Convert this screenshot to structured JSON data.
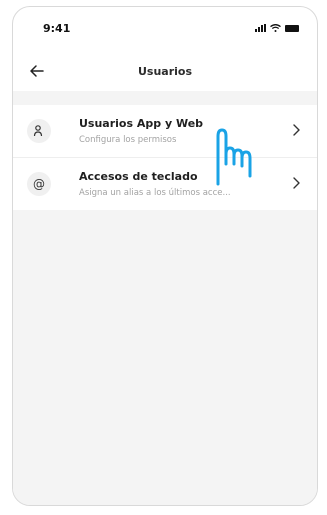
{
  "status_bar": {
    "time": "9:41"
  },
  "header": {
    "title": "Usuarios"
  },
  "items": [
    {
      "title": "Usuarios App y Web",
      "subtitle": "Configura los permisos",
      "icon": "users-icon"
    },
    {
      "title": "Accesos de teclado",
      "subtitle": "Asigna un alias a los últimos acce...",
      "icon": "at-sign-icon"
    }
  ],
  "colors": {
    "accent": "#1aa3e6"
  }
}
